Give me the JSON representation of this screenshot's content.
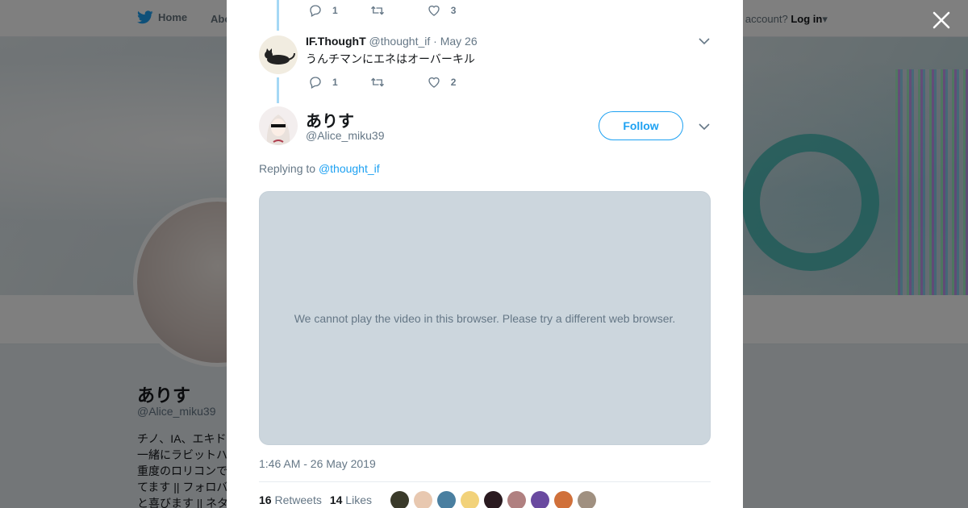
{
  "nav": {
    "home_label": "Home",
    "about_label": "About",
    "account_prompt": "e an account?",
    "login_label": "Log in"
  },
  "profile": {
    "name": "ありす",
    "handle": "@Alice_miku39",
    "bio": "チノ、IA、エキド 一緒にラビットハ 重度のロリコンで てます || フォロバ と喜びます || ネタ"
  },
  "reply_tweet": {
    "name": "IF.ThoughT",
    "handle": "@thought_if",
    "date": "· May 26",
    "text": "うんチマンにエネはオーバーキル",
    "replies": "1",
    "retweets": "",
    "likes": "2"
  },
  "prev_tweet": {
    "replies": "1",
    "likes": "3"
  },
  "main_tweet": {
    "name": "ありす",
    "handle": "@Alice_miku39",
    "follow_label": "Follow",
    "replying_prefix": "Replying to",
    "replying_to": "@thought_if",
    "video_message": "We cannot play the video in this browser. Please try a different web browser.",
    "timestamp": "1:46 AM - 26 May 2019",
    "retweet_count": "16",
    "retweet_label": "Retweets",
    "like_count": "14",
    "like_label": "Likes"
  },
  "liker_colors": [
    "#3a3a2a",
    "#e8c8b0",
    "#4a7fa0",
    "#f2d27a",
    "#2a1a20",
    "#b08080",
    "#6a4aa0",
    "#d0703a",
    "#a09080"
  ]
}
